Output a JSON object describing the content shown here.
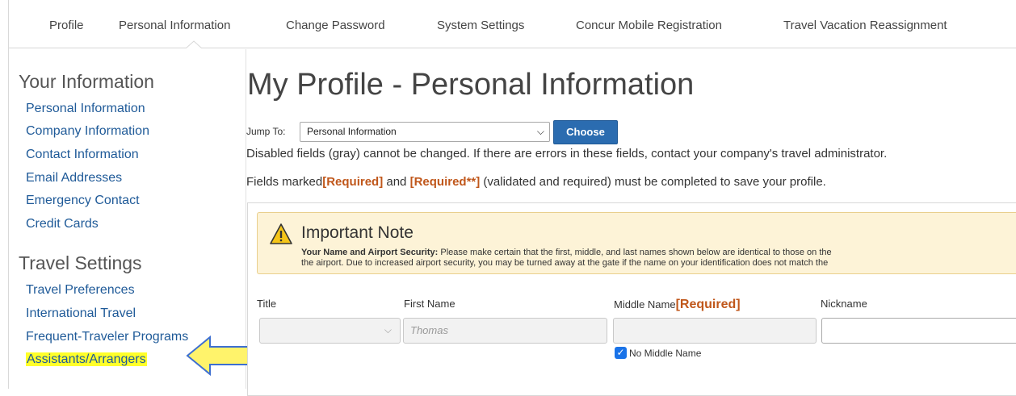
{
  "topnav": {
    "tabs": [
      "Profile",
      "Personal Information",
      "Change Password",
      "System Settings",
      "Concur Mobile Registration",
      "Travel Vacation Reassignment"
    ],
    "active_index": 1
  },
  "sidebar": {
    "your_information": {
      "heading": "Your Information",
      "links": [
        "Personal Information",
        "Company Information",
        "Contact Information",
        "Email Addresses",
        "Emergency Contact",
        "Credit Cards"
      ]
    },
    "travel_settings": {
      "heading": "Travel Settings",
      "links": [
        "Travel Preferences",
        "International Travel",
        "Frequent-Traveler Programs",
        "Assistants/Arrangers"
      ],
      "highlighted_index": 3
    }
  },
  "main": {
    "title": "My Profile - Personal Information",
    "jump_label": "Jump To:",
    "jump_value": "Personal Information",
    "choose_label": "Choose",
    "disabled_text": "Disabled fields (gray) cannot be changed. If there are errors in these fields, contact your company's travel administrator.",
    "fields_marked_prefix": "Fields marked",
    "required_label": "[Required]",
    "and_text": " and ",
    "required_star_label": "[Required**]",
    "fields_marked_suffix": " (validated and required) must be completed to save your profile."
  },
  "note": {
    "title": "Important Note",
    "bold_prefix": "Your Name and Airport Security:",
    "line1": " Please make certain that the first, middle, and last names shown below are identical to those on the",
    "line2": "the airport. Due to increased airport security, you may be turned away at the gate if the name on your identification does not match the"
  },
  "form": {
    "title_label": "Title",
    "first_name_label": "First Name",
    "first_name_value": "Thomas",
    "middle_name_label": "Middle Name",
    "middle_required": "[Required]",
    "nickname_label": "Nickname",
    "no_middle_name_label": "No Middle Name",
    "no_middle_name_checked": true
  },
  "colors": {
    "link": "#1f5a98",
    "required": "#c0571b",
    "button": "#2b6cb0",
    "highlight": "#ffff2a",
    "note_bg": "#fdf3d7",
    "arrow_fill": "#fff36b",
    "arrow_stroke": "#3d6fd1"
  },
  "icons": {
    "warning": "warning-triangle-icon",
    "arrow": "pointer-arrow-icon",
    "chevron": "chevron-down-icon",
    "check": "checkmark-icon"
  }
}
